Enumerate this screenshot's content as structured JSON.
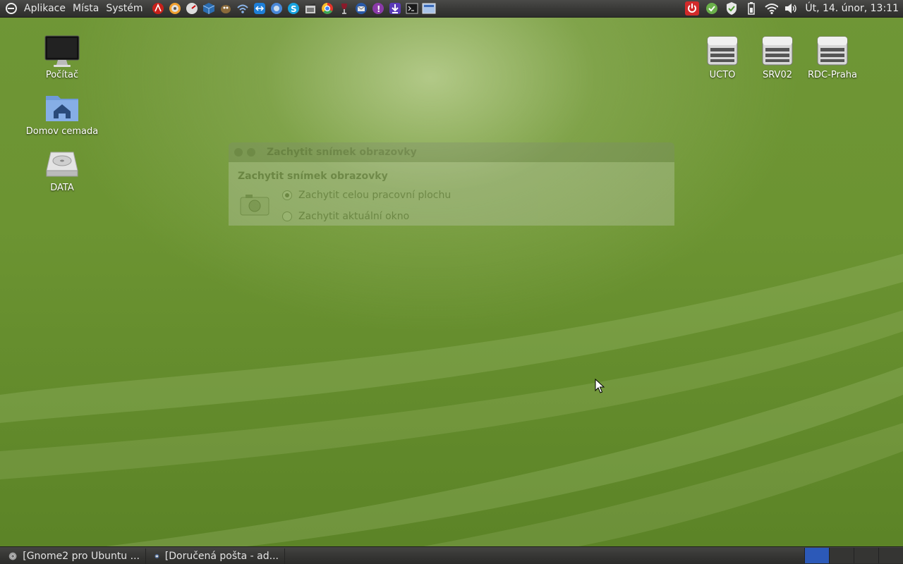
{
  "top_panel": {
    "menus": [
      "Aplikace",
      "Místa",
      "Systém"
    ],
    "launchers": [
      {
        "icon": "adobe-reader-icon"
      },
      {
        "icon": "disc-burner-icon"
      },
      {
        "icon": "tacho-icon"
      },
      {
        "icon": "virtualbox-icon"
      },
      {
        "icon": "gimp-icon"
      },
      {
        "icon": "wireless-tool-icon"
      },
      {
        "icon": "teamviewer-icon"
      },
      {
        "icon": "network-browser-icon"
      },
      {
        "icon": "skype-icon"
      },
      {
        "icon": "video-editor-icon"
      },
      {
        "icon": "chrome-icon"
      },
      {
        "icon": "wine-icon"
      },
      {
        "icon": "thunderbird-icon"
      },
      {
        "icon": "empathy-icon"
      },
      {
        "icon": "download-icon"
      },
      {
        "icon": "terminal-icon"
      },
      {
        "icon": "screenshot-icon"
      }
    ],
    "tray": [
      {
        "icon": "power-icon"
      },
      {
        "icon": "update-manager-icon"
      },
      {
        "icon": "security-shield-icon"
      },
      {
        "icon": "battery-icon"
      },
      {
        "icon": "wifi-icon"
      },
      {
        "icon": "volume-icon"
      }
    ],
    "clock": "Út, 14. únor, 13:11"
  },
  "desktop": {
    "left_icons": [
      {
        "label": "Počítač",
        "icon": "computer-monitor-icon"
      },
      {
        "label": "Domov cemada",
        "icon": "home-folder-icon"
      },
      {
        "label": "DATA",
        "icon": "hard-drive-icon"
      }
    ],
    "right_icons": [
      {
        "label": "UCTO",
        "icon": "network-server-icon"
      },
      {
        "label": "SRV02",
        "icon": "network-server-icon"
      },
      {
        "label": "RDC-Praha",
        "icon": "network-server-icon"
      }
    ]
  },
  "dialog": {
    "title": "Zachytit snímek obrazovky",
    "heading": "Zachytit snímek obrazovky",
    "options": [
      {
        "label": "Zachytit celou pracovní plochu",
        "checked": true
      },
      {
        "label": "Zachytit aktuální okno",
        "checked": false
      }
    ]
  },
  "bottom_panel": {
    "tasks": [
      {
        "label": "[Gnome2 pro Ubuntu ...",
        "icon": "chrome-icon"
      },
      {
        "label": "[Doručená pošta - ad...",
        "icon": "thunderbird-icon"
      }
    ],
    "workspaces": 4,
    "active_workspace": 1,
    "accent": "#2c59b8"
  }
}
